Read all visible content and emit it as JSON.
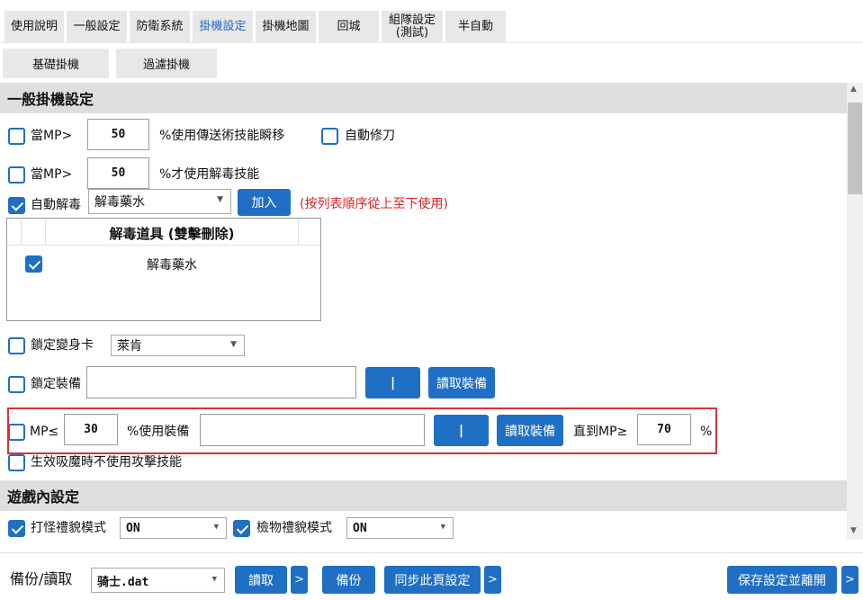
{
  "tabs": [
    "使用說明",
    "一般設定",
    "防衛系統",
    "掛機設定",
    "掛機地圖",
    "回城",
    "組隊設定\n(測試)",
    "半自動"
  ],
  "tab_line1": "組隊設定",
  "tab_line2": "(測試)",
  "active_tab": "掛機設定",
  "subtabs": [
    "基礎掛機",
    "過濾掛機"
  ],
  "section_general": "一般掛機設定",
  "rows": {
    "mp_teleport": {
      "label": "當MP>",
      "value": "50",
      "suffix": "%使用傳送術技能瞬移"
    },
    "auto_repair": {
      "label": "自動修刀"
    },
    "mp_cure": {
      "label": "當MP>",
      "value": "50",
      "suffix": "%才使用解毒技能"
    },
    "auto_detox": {
      "label": "自動解毒",
      "selected": "解毒藥水",
      "add_label": "加入",
      "hint": "(按列表順序從上至下使用)"
    },
    "detox_list": {
      "header": "解毒道具 (雙擊刪除)",
      "items": [
        "解毒藥水"
      ]
    },
    "lock_card": {
      "label": "鎖定變身卡",
      "selected": "萊肯"
    },
    "lock_equip": {
      "label": "鎖定裝備",
      "pipe": "|",
      "read_label": "讀取裝備"
    },
    "mp_equip": {
      "label": "MP≤",
      "value": "30",
      "mid": "%使用裝備",
      "pipe": "|",
      "read_label": "讀取裝備",
      "until": "直到MP≥",
      "until_value": "70",
      "unit": "%"
    },
    "no_attack": {
      "label": "生效吸魔時不使用攻擊技能"
    }
  },
  "section_game": "遊戲內設定",
  "game": {
    "monster_label": "打怪禮貌模式",
    "monster_value": "ON",
    "loot_label": "檢物禮貌模式",
    "loot_value": "ON"
  },
  "bottom": {
    "backup_label": "備份/讀取",
    "file": "骑士.dat",
    "read": "讀取",
    "backup": "備份",
    "sync": "同步此頁設定",
    "save": "保存設定並離開",
    "arrow": ">"
  },
  "colors": {
    "accent": "#1f6fc5",
    "active_tab": "#2266cc",
    "hint": "#e02020",
    "highlight_box": "#e03030"
  }
}
